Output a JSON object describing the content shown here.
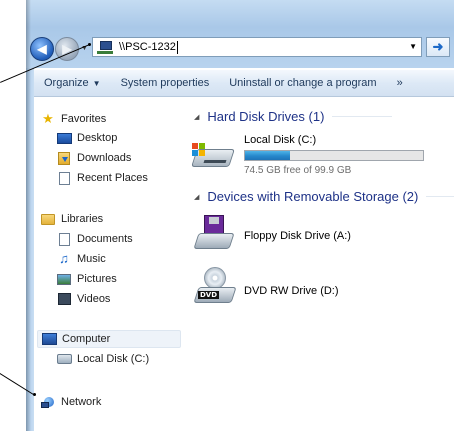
{
  "address_bar": {
    "path": "\\\\PSC-1232"
  },
  "toolbar": {
    "organize": "Organize",
    "system_properties": "System properties",
    "uninstall": "Uninstall or change a program",
    "more": "»"
  },
  "sidebar": {
    "favorites": {
      "header": "Favorites",
      "items": [
        "Desktop",
        "Downloads",
        "Recent Places"
      ]
    },
    "libraries": {
      "header": "Libraries",
      "items": [
        "Documents",
        "Music",
        "Pictures",
        "Videos"
      ]
    },
    "computer": {
      "header": "Computer",
      "items": [
        "Local Disk (C:)"
      ]
    },
    "network": {
      "header": "Network"
    }
  },
  "content": {
    "hard_disk_group": "Hard Disk Drives (1)",
    "local_disk": {
      "name": "Local Disk (C:)",
      "free_text": "74.5 GB free of 99.9 GB",
      "used_fraction": 0.254
    },
    "removable_group": "Devices with Removable Storage (2)",
    "floppy": "Floppy Disk Drive (A:)",
    "dvd": "DVD RW Drive (D:)"
  }
}
